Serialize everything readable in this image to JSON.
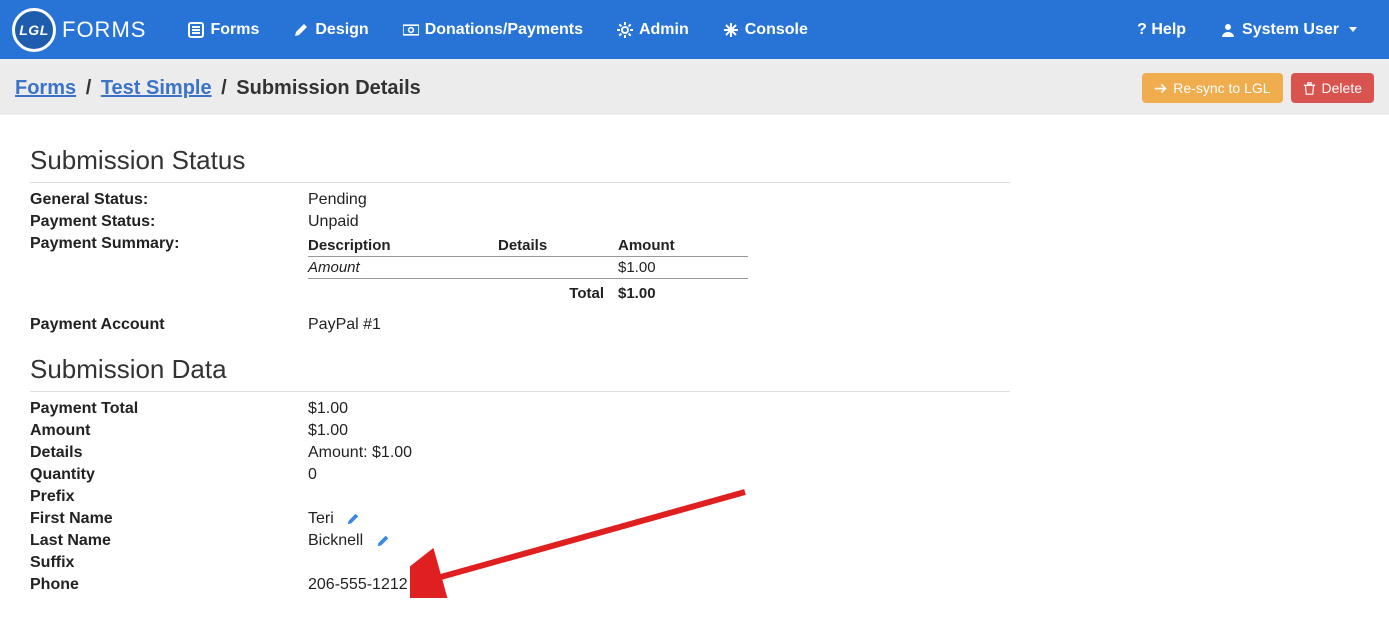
{
  "logo": {
    "badge": "LGL",
    "text": "FORMS"
  },
  "nav": {
    "forms": "Forms",
    "design": "Design",
    "donations": "Donations/Payments",
    "admin": "Admin",
    "console": "Console",
    "help": "? Help",
    "user": "System User"
  },
  "breadcrumb": {
    "forms": "Forms",
    "form_name": "Test Simple",
    "page": "Submission Details"
  },
  "actions": {
    "resync": "Re-sync to LGL",
    "delete": "Delete"
  },
  "sections": {
    "status_title": "Submission Status",
    "data_title": "Submission Data"
  },
  "status": {
    "general_label": "General Status:",
    "general_value": "Pending",
    "payment_status_label": "Payment Status:",
    "payment_status_value": "Unpaid",
    "summary_label": "Payment Summary:",
    "summary_headers": {
      "desc": "Description",
      "details": "Details",
      "amount": "Amount"
    },
    "summary_row": {
      "desc": "Amount",
      "details": "",
      "amount": "$1.00"
    },
    "summary_total_label": "Total",
    "summary_total_value": "$1.00",
    "account_label": "Payment Account",
    "account_value": "PayPal #1"
  },
  "data": {
    "payment_total_label": "Payment Total",
    "payment_total_value": "$1.00",
    "amount_label": "Amount",
    "amount_value": "$1.00",
    "details_label": "Details",
    "details_value": "Amount: $1.00",
    "quantity_label": "Quantity",
    "quantity_value": "0",
    "prefix_label": "Prefix",
    "prefix_value": "",
    "first_name_label": "First Name",
    "first_name_value": "Teri",
    "last_name_label": "Last Name",
    "last_name_value": "Bicknell",
    "suffix_label": "Suffix",
    "suffix_value": "",
    "phone_label": "Phone",
    "phone_value": "206-555-1212"
  }
}
